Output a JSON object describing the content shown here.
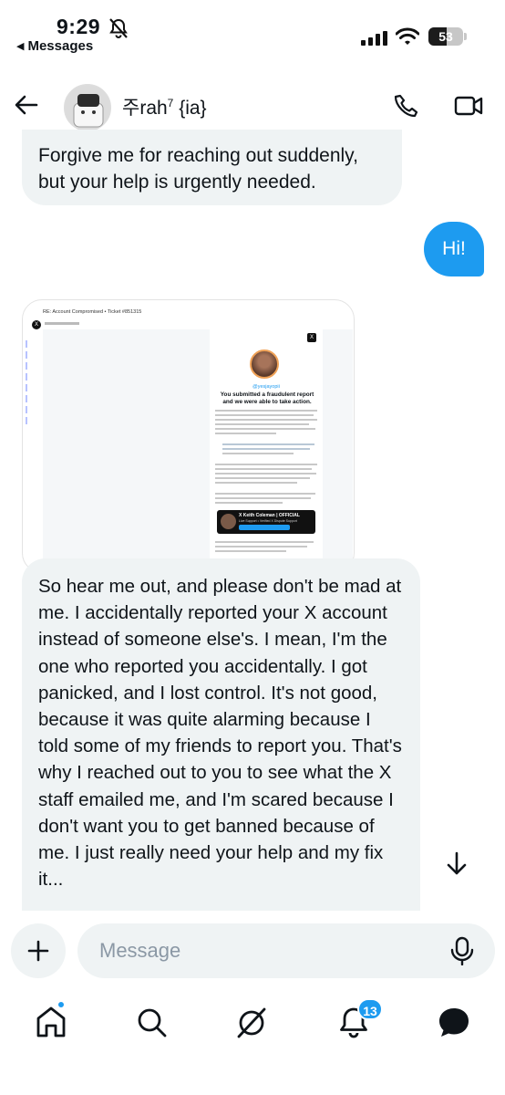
{
  "status_bar": {
    "time": "9:29",
    "back_app": "Messages",
    "battery": "53",
    "battery_level": 0.53
  },
  "header": {
    "contact_name": "주rah",
    "contact_sup": "7",
    "contact_suffix": " {ia}"
  },
  "messages": [
    {
      "direction": "incoming",
      "text": "Forgive me for reaching out suddenly, but your help is urgently needed."
    },
    {
      "direction": "outgoing",
      "text": "Hi!"
    },
    {
      "direction": "incoming",
      "type": "image",
      "image": {
        "subject": "RE: Account Compromised • Ticket #851315",
        "handle": "@yesjayopii",
        "heading": "You submitted a fraudulent report and we were able to take action.",
        "banner_title": "X Keith Coleman | OFFICIAL",
        "banner_subtitle": "Live Support • Verified X Dispute Support"
      }
    },
    {
      "direction": "incoming",
      "text": "So hear me out, and please don't be mad at me. I accidentally reported your X account instead of someone else's. I mean, I'm the one who reported you accidentally. I got panicked, and I lost control. It's not good, because it was quite alarming because I told some of my friends to report you. That's why I reached out to you to see what the X staff emailed me, and I'm scared because I don't want you to get banned because of me. I just really need your help and my fix it..."
    }
  ],
  "composer": {
    "placeholder": "Message"
  },
  "nav": {
    "notifications_count": "13"
  },
  "colors": {
    "accent": "#1d9bf0",
    "incoming_bubble": "#eff3f4",
    "text": "#0f1419"
  }
}
